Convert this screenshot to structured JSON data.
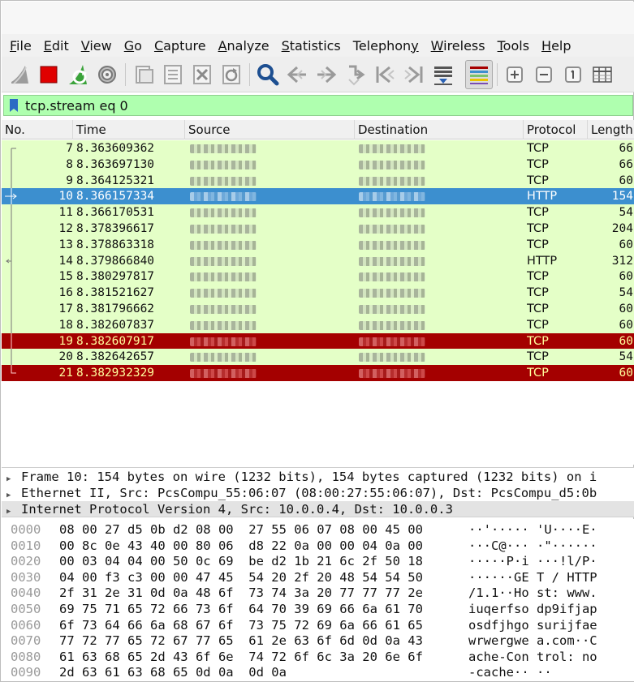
{
  "menu": [
    "File",
    "Edit",
    "View",
    "Go",
    "Capture",
    "Analyze",
    "Statistics",
    "Telephony",
    "Wireless",
    "Tools",
    "Help"
  ],
  "menu_underline": [
    "F",
    "E",
    "V",
    "G",
    "C",
    "A",
    "S",
    "y",
    "W",
    "T",
    "H"
  ],
  "toolbar": {
    "icons": [
      "start-capture-icon",
      "stop-capture-icon",
      "restart-capture-icon",
      "capture-options-icon",
      "open-file-icon",
      "save-file-icon",
      "close-file-icon",
      "reload-file-icon",
      "find-packet-icon",
      "go-back-icon",
      "go-forward-icon",
      "go-to-packet-icon",
      "first-packet-icon",
      "last-packet-icon",
      "autoscroll-icon",
      "colorize-icon",
      "zoom-in-icon",
      "zoom-out-icon",
      "normal-size-icon",
      "resize-columns-icon"
    ]
  },
  "filter": {
    "text": "tcp.stream eq 0"
  },
  "columns": [
    "No.",
    "Time",
    "Source",
    "Destination",
    "Protocol",
    "Length"
  ],
  "packets": [
    {
      "no": "7",
      "time": "8.363609362",
      "protocol": "TCP",
      "length": "66",
      "style": "normal"
    },
    {
      "no": "8",
      "time": "8.363697130",
      "protocol": "TCP",
      "length": "66",
      "style": "normal"
    },
    {
      "no": "9",
      "time": "8.364125321",
      "protocol": "TCP",
      "length": "60",
      "style": "normal"
    },
    {
      "no": "10",
      "time": "8.366157334",
      "protocol": "HTTP",
      "length": "154",
      "style": "selected"
    },
    {
      "no": "11",
      "time": "8.366170531",
      "protocol": "TCP",
      "length": "54",
      "style": "normal"
    },
    {
      "no": "12",
      "time": "8.378396617",
      "protocol": "TCP",
      "length": "204",
      "style": "normal"
    },
    {
      "no": "13",
      "time": "8.378863318",
      "protocol": "TCP",
      "length": "60",
      "style": "normal"
    },
    {
      "no": "14",
      "time": "8.379866840",
      "protocol": "HTTP",
      "length": "312",
      "style": "normal"
    },
    {
      "no": "15",
      "time": "8.380297817",
      "protocol": "TCP",
      "length": "60",
      "style": "normal"
    },
    {
      "no": "16",
      "time": "8.381521627",
      "protocol": "TCP",
      "length": "54",
      "style": "normal"
    },
    {
      "no": "17",
      "time": "8.381796662",
      "protocol": "TCP",
      "length": "60",
      "style": "normal"
    },
    {
      "no": "18",
      "time": "8.382607837",
      "protocol": "TCP",
      "length": "60",
      "style": "normal"
    },
    {
      "no": "19",
      "time": "8.382607917",
      "protocol": "TCP",
      "length": "60",
      "style": "bad"
    },
    {
      "no": "20",
      "time": "8.382642657",
      "protocol": "TCP",
      "length": "54",
      "style": "normal"
    },
    {
      "no": "21",
      "time": "8.382932329",
      "protocol": "TCP",
      "length": "60",
      "style": "bad"
    }
  ],
  "details": [
    "Frame 10: 154 bytes on wire (1232 bits), 154 bytes captured (1232 bits) on i",
    "Ethernet II, Src: PcsCompu_55:06:07 (08:00:27:55:06:07), Dst: PcsCompu_d5:0b",
    "Internet Protocol Version 4, Src: 10.0.0.4, Dst: 10.0.0.3"
  ],
  "bytes": [
    {
      "offset": "0000",
      "hex": "08 00 27 d5 0b d2 08 00  27 55 06 07 08 00 45 00",
      "ascii": "··'····· 'U····E·"
    },
    {
      "offset": "0010",
      "hex": "00 8c 0e 43 40 00 80 06  d8 22 0a 00 00 04 0a 00",
      "ascii": "···C@··· ·\"······"
    },
    {
      "offset": "0020",
      "hex": "00 03 04 04 00 50 0c 69  be d2 1b 21 6c 2f 50 18",
      "ascii": "·····P·i ···!l/P·"
    },
    {
      "offset": "0030",
      "hex": "04 00 f3 c3 00 00 47 45  54 20 2f 20 48 54 54 50",
      "ascii": "······GE T / HTTP"
    },
    {
      "offset": "0040",
      "hex": "2f 31 2e 31 0d 0a 48 6f  73 74 3a 20 77 77 77 2e",
      "ascii": "/1.1··Ho st: www."
    },
    {
      "offset": "0050",
      "hex": "69 75 71 65 72 66 73 6f  64 70 39 69 66 6a 61 70",
      "ascii": "iuqerfso dp9ifjap"
    },
    {
      "offset": "0060",
      "hex": "6f 73 64 66 6a 68 67 6f  73 75 72 69 6a 66 61 65",
      "ascii": "osdfjhgo surijfae"
    },
    {
      "offset": "0070",
      "hex": "77 72 77 65 72 67 77 65  61 2e 63 6f 6d 0d 0a 43",
      "ascii": "wrwergwe a.com··C"
    },
    {
      "offset": "0080",
      "hex": "61 63 68 65 2d 43 6f 6e  74 72 6f 6c 3a 20 6e 6f",
      "ascii": "ache-Con trol: no"
    },
    {
      "offset": "0090",
      "hex": "2d 63 61 63 68 65 0d 0a  0d 0a",
      "ascii": "-cache·· ··"
    }
  ]
}
